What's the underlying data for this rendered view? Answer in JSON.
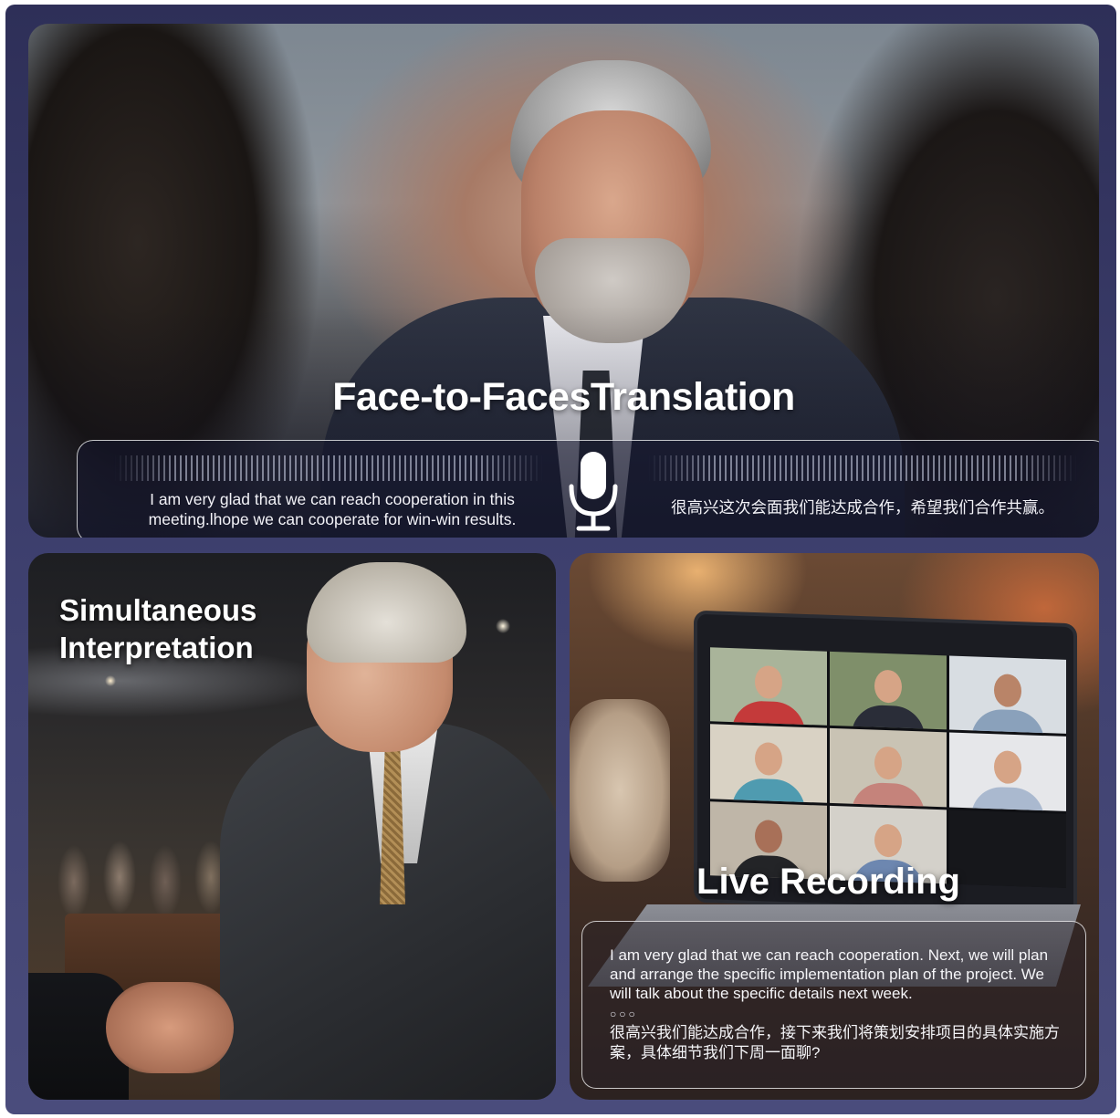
{
  "face_to_face": {
    "title": "Face-to-FacesTranslation",
    "source_text": "I am very glad that we can reach cooperation in this meeting.lhope we can cooperate for win-win results.",
    "target_text": "很高兴这次会面我们能达成合作，希望我们合作共赢。",
    "icon": "microphone-icon"
  },
  "simultaneous": {
    "title_line1": "Simultaneous",
    "title_line2": "Interpretation"
  },
  "live_recording": {
    "title": "Live Recording",
    "english_text": "I am very glad that we can reach cooperation. Next, we will plan and arrange the specific implementation plan of the project. We will talk about the specific details next week.",
    "dots": "○○○",
    "chinese_text": "很高兴我们能达成合作，接下来我们将策划安排项目的具体实施方案，具体细节我们下周一面聊?"
  },
  "colors": {
    "frame": "#3f4170",
    "text": "#ffffff"
  }
}
